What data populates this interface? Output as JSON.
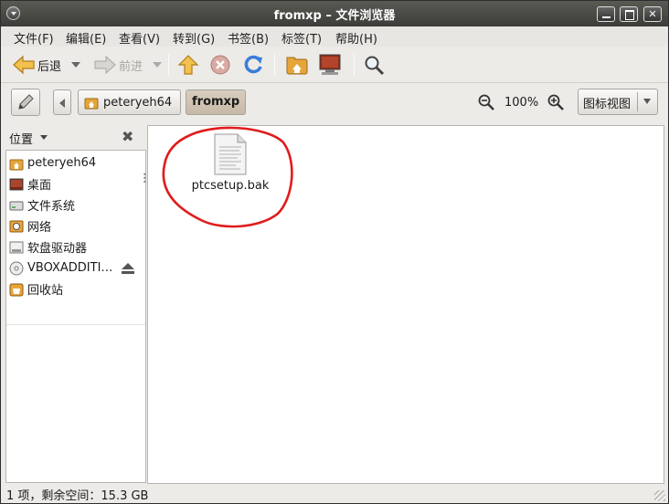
{
  "window": {
    "title": "fromxp – 文件浏览器"
  },
  "menu": [
    "文件(F)",
    "编辑(E)",
    "查看(V)",
    "转到(G)",
    "书签(B)",
    "标签(T)",
    "帮助(H)"
  ],
  "toolbar": {
    "back_label": "后退",
    "forward_label": "前进"
  },
  "location": {
    "crumbs": [
      "peteryeh64",
      "fromxp"
    ],
    "zoom": "100%",
    "view_mode": "图标视图"
  },
  "sidebar": {
    "header": "位置",
    "items": [
      {
        "label": "peteryeh64",
        "icon": "home-folder-icon"
      },
      {
        "label": "桌面",
        "icon": "desktop-icon"
      },
      {
        "label": "文件系统",
        "icon": "filesystem-icon"
      },
      {
        "label": "网络",
        "icon": "network-icon"
      },
      {
        "label": "软盘驱动器",
        "icon": "floppy-icon"
      },
      {
        "label": "VBOXADDITI…",
        "icon": "cdrom-icon"
      },
      {
        "label": "回收站",
        "icon": "trash-icon"
      }
    ]
  },
  "files": [
    {
      "name": "ptcsetup.bak",
      "icon": "text-file-icon"
    }
  ],
  "status": "1 项，剩余空间：15.3 GB",
  "colors": {
    "annotation": "#e11b1b",
    "title_bar": "#4a4a46",
    "window_bg": "#edebe8",
    "active_crumb": "#cbbfae"
  }
}
